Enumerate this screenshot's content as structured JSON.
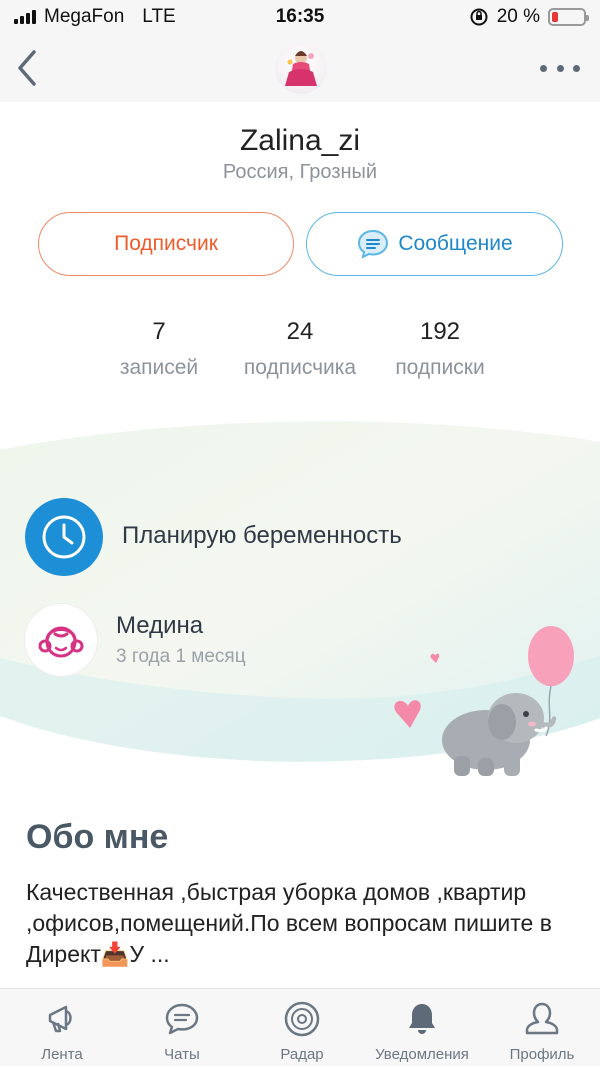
{
  "status_bar": {
    "carrier": "MegaFon",
    "network": "LTE",
    "time": "16:35",
    "battery": "20 %",
    "battery_level": 0.2
  },
  "profile": {
    "username": "Zalina_zi",
    "location": "Россия, Грозный",
    "subscribe_button": "Подписчик",
    "message_button": "Сообщение"
  },
  "stats": [
    {
      "value": "7",
      "label": "записей"
    },
    {
      "value": "24",
      "label": "подписчика"
    },
    {
      "value": "192",
      "label": "подписки"
    }
  ],
  "status": {
    "plan": "Планирую беременность",
    "child_name": "Медина",
    "child_age": "3 года 1 месяц"
  },
  "about": {
    "title": "Обо мне",
    "text": "Качественная ,быстрая уборка домов  ,квартир ,офисов,помещений.По всем вопросам пишите в Директ📥У ..."
  },
  "tabs": [
    {
      "label": "Лента",
      "icon": "megaphone-icon"
    },
    {
      "label": "Чаты",
      "icon": "chat-icon"
    },
    {
      "label": "Радар",
      "icon": "radar-icon"
    },
    {
      "label": "Уведомления",
      "icon": "bell-icon"
    },
    {
      "label": "Профиль",
      "icon": "profile-icon"
    }
  ],
  "colors": {
    "accent_orange": "#ec5d2b",
    "accent_blue": "#1e88c9",
    "clock_blue": "#1d8fd6",
    "child_pink": "#d63384"
  }
}
